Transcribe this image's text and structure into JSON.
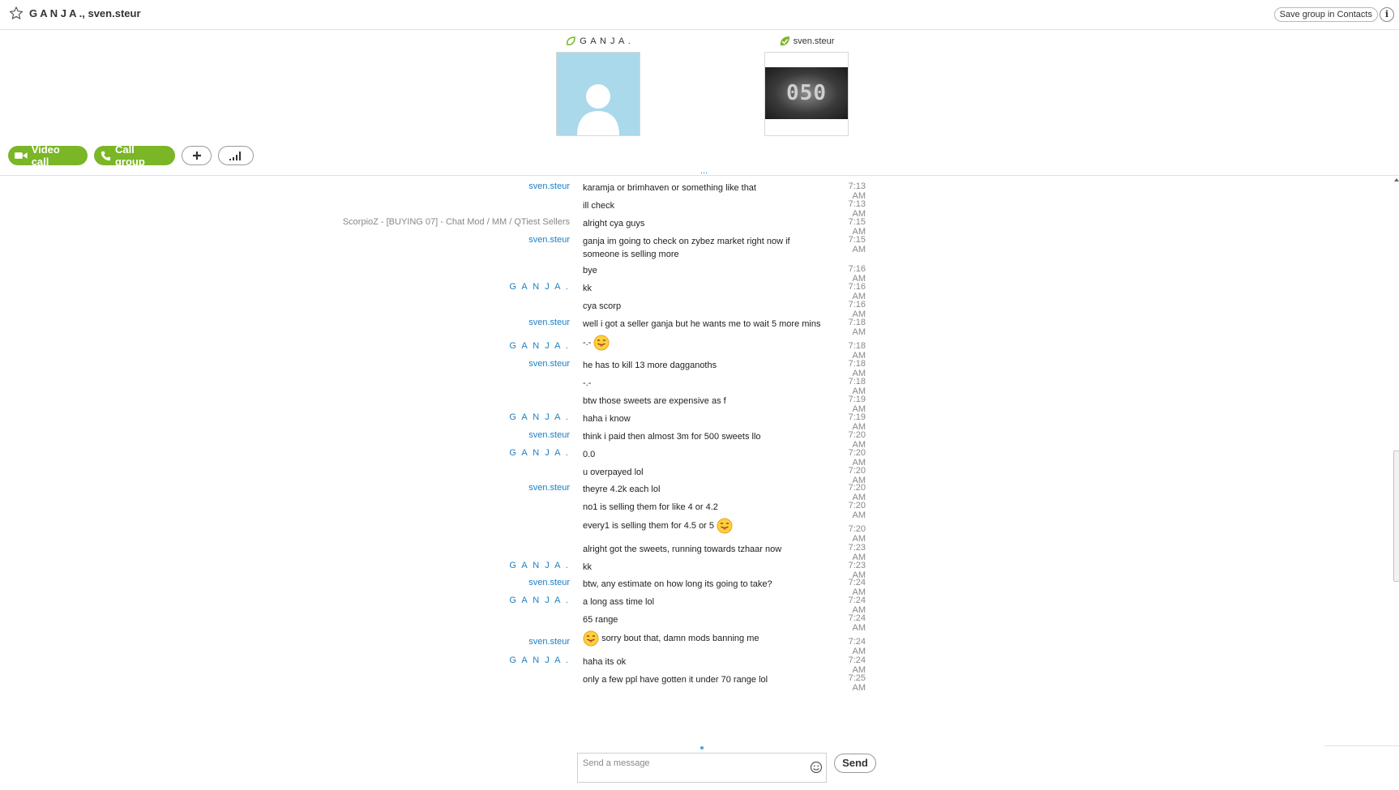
{
  "header": {
    "title": "G A N J A ., sven.steur",
    "save_group_label": "Save group in Contacts",
    "info_label": "i"
  },
  "participants": [
    {
      "name": "G A N J A ."
    },
    {
      "name": "sven.steur",
      "avatar_text": "050"
    }
  ],
  "actions": {
    "video_call_label": "Video call",
    "call_group_label": "Call group",
    "add_label": "+"
  },
  "chat": {
    "load_more": "...",
    "messages": [
      {
        "sender": "sven.steur",
        "text": "karamja or brimhaven or something like that",
        "time": "7:13 AM"
      },
      {
        "sender": "",
        "text": "ill check",
        "time": "7:13 AM"
      },
      {
        "sender": "ScorpioZ - [BUYING 07] - Chat Mod / MM / QTiest Sellers",
        "text": "alright cya guys",
        "time": "7:15 AM"
      },
      {
        "sender": "sven.steur",
        "text": "ganja im  going to check on zybez market right now if someone is selling more",
        "time": "7:15 AM"
      },
      {
        "sender": "",
        "text": "bye",
        "time": "7:16 AM"
      },
      {
        "sender": "G A N J A .",
        "text": "kk",
        "time": "7:16 AM"
      },
      {
        "sender": "",
        "text": "cya scorp",
        "time": "7:16 AM"
      },
      {
        "sender": "sven.steur",
        "text": "well i got a seller ganja but he wants me to wait 5 more mins",
        "time": "7:18 AM"
      },
      {
        "sender": "G A N J A .",
        "text": "-.-",
        "time": "7:18 AM"
      },
      {
        "sender": "sven.steur",
        "text": "he has to kill 13 more dagganoths",
        "time": "7:18 AM"
      },
      {
        "sender": "",
        "text": "-.-",
        "time": "7:18 AM"
      },
      {
        "sender": "",
        "text": "btw those sweets are expensive as f",
        "time": "7:19 AM"
      },
      {
        "sender": "G A N J A .",
        "text": "haha i know",
        "time": "7:19 AM"
      },
      {
        "sender": "sven.steur",
        "text": "think i paid then almost 3m for 500 sweets llo",
        "time": "7:20 AM"
      },
      {
        "sender": "G A N J A .",
        "text": "0.0",
        "time": "7:20 AM"
      },
      {
        "sender": "",
        "text": "u overpayed lol",
        "time": "7:20 AM"
      },
      {
        "sender": "sven.steur",
        "text": "theyre 4.2k each lol",
        "time": "7:20 AM"
      },
      {
        "sender": "",
        "text": "no1 is selling them  for like 4 or 4.2",
        "time": "7:20 AM"
      },
      {
        "sender": "",
        "text": "every1 is selling them for 4.5 or 5",
        "time": "7:20 AM"
      },
      {
        "sender": "",
        "text": "alright got the sweets, running towards tzhaar now",
        "time": "7:23 AM"
      },
      {
        "sender": "G A N J A .",
        "text": "kk",
        "time": "7:23 AM"
      },
      {
        "sender": "sven.steur",
        "text": "btw, any estimate on how long its going to take?",
        "time": "7:24 AM"
      },
      {
        "sender": "G A N J A .",
        "text": "a long ass time lol",
        "time": "7:24 AM"
      },
      {
        "sender": "",
        "text": "65 range",
        "time": "7:24 AM"
      },
      {
        "sender": "sven.steur",
        "text": "sorry bout that, damn mods banning me",
        "time": "7:24 AM"
      },
      {
        "sender": "G A N J A .",
        "text": "haha its ok",
        "time": "7:24 AM"
      },
      {
        "sender": "",
        "text": "only a few ppl have gotten it under 70 range lol",
        "time": "7:25 AM"
      }
    ]
  },
  "composer": {
    "placeholder": "Send a message",
    "send_label": "Send"
  },
  "colors": {
    "accent_green": "#7ab626",
    "link_blue": "#1a7fc4",
    "avatar_bg": "#a9d9ea"
  }
}
